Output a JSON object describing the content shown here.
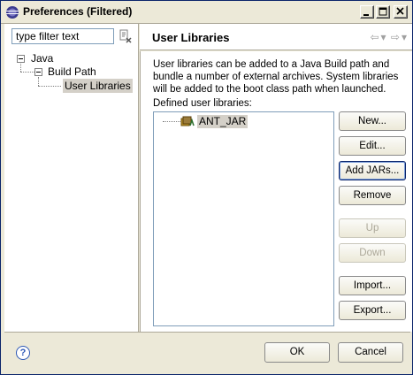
{
  "window": {
    "title": "Preferences (Filtered)"
  },
  "filter": {
    "placeholder": "type filter text"
  },
  "tree": {
    "items": [
      {
        "label": "Java"
      },
      {
        "label": "Build Path"
      },
      {
        "label": "User Libraries"
      }
    ]
  },
  "page": {
    "title": "User Libraries",
    "description": "User libraries can be added to a Java Build path and bundle a number of external archives. System libraries will be added to the boot class path when launched.",
    "defined_label": "Defined user libraries:",
    "libraries": [
      {
        "label": "ANT_JAR"
      }
    ]
  },
  "buttons": {
    "new": "New...",
    "edit": "Edit...",
    "add_jars": "Add JARs...",
    "remove": "Remove",
    "up": "Up",
    "down": "Down",
    "import": "Import...",
    "export": "Export..."
  },
  "footer": {
    "ok": "OK",
    "cancel": "Cancel"
  }
}
